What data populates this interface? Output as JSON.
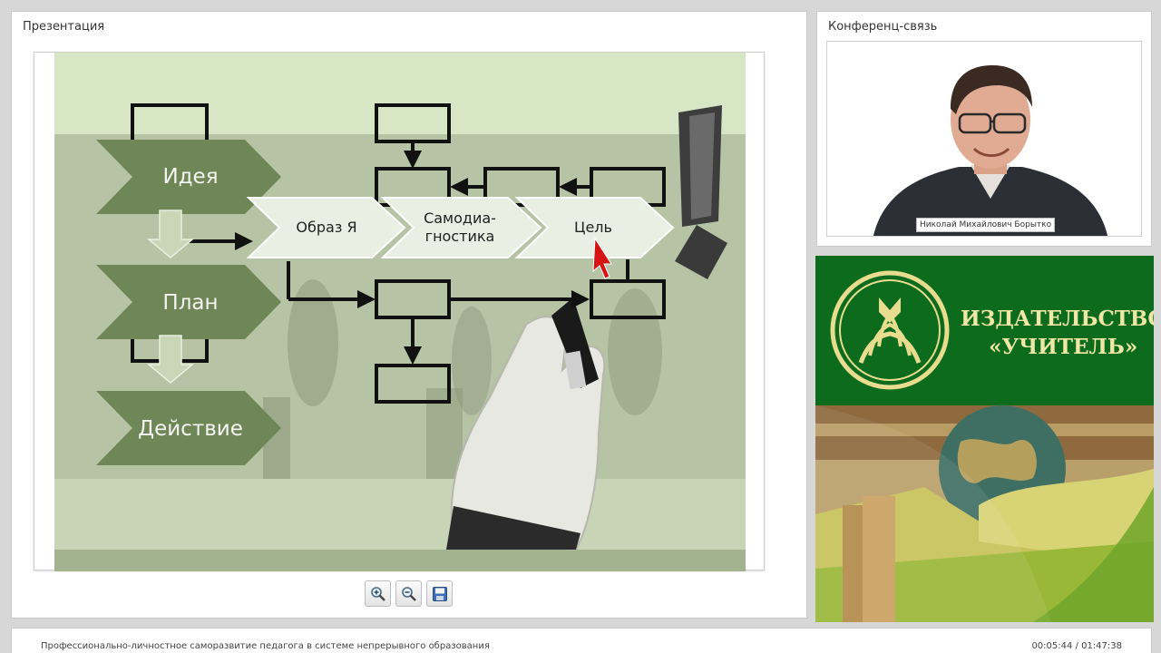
{
  "presentation": {
    "title": "Презентация",
    "slide": {
      "chevrons_left": [
        "Идея",
        "План",
        "Действие"
      ],
      "chevrons_mid": [
        "Образ Я",
        "Самодиа-",
        "гностика",
        "Цель"
      ]
    },
    "toolbar": {
      "zoom_in": "zoom-in-icon",
      "zoom_out": "zoom-out-icon",
      "save": "save-icon"
    }
  },
  "conference": {
    "title": "Конференц-связь",
    "speaker_name": "Николай Михайлович Борытко"
  },
  "publisher": {
    "line1": "ИЗДАТЕЛЬСТВО",
    "line2": "«УЧИТЕЛЬ»"
  },
  "footer": {
    "title": "Профессионально-личностное саморазвитие педагога в системе непрерывного образования",
    "time": "00:05:44 / 01:47:38"
  },
  "colors": {
    "slide_bg": "#d6e6c4",
    "chevron_dark": "#6f8756",
    "chevron_light": "#e9efe2",
    "publisher_green": "#0d6b1e",
    "publisher_gold": "#f0e7a6"
  }
}
